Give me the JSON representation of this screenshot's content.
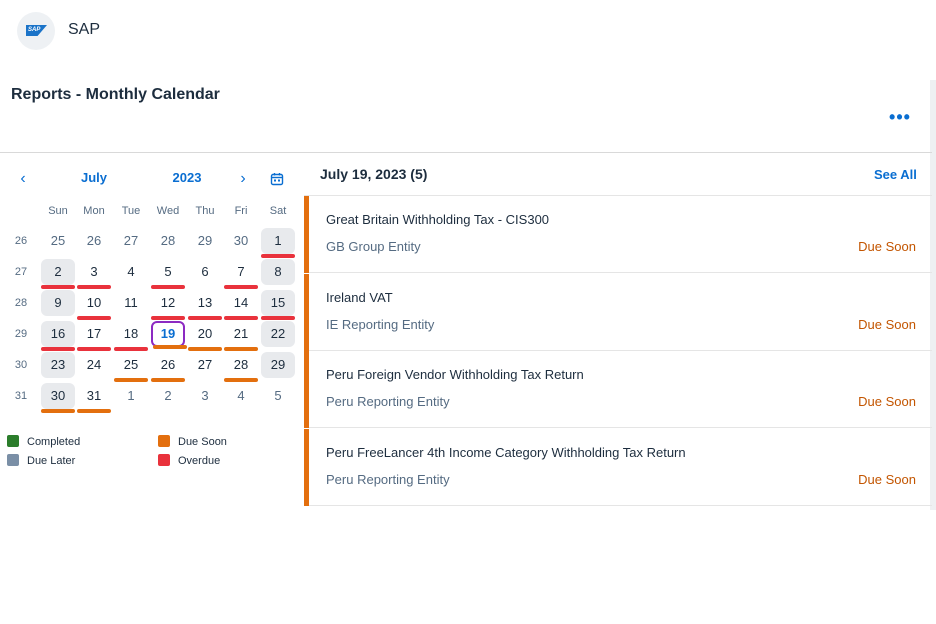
{
  "shell": {
    "logo_text": "SAP",
    "title": "SAP"
  },
  "page": {
    "title": "Reports - Monthly Calendar",
    "more_label": "•••"
  },
  "calendar": {
    "prev_label": "‹",
    "next_label": "›",
    "month": "July",
    "year": "2023",
    "weekdays": [
      "Sun",
      "Mon",
      "Tue",
      "Wed",
      "Thu",
      "Fri",
      "Sat"
    ],
    "weeks": [
      {
        "num": "26",
        "days": [
          {
            "d": "25",
            "other": true
          },
          {
            "d": "26",
            "other": true
          },
          {
            "d": "27",
            "other": true
          },
          {
            "d": "28",
            "other": true
          },
          {
            "d": "29",
            "other": true
          },
          {
            "d": "30",
            "other": true
          },
          {
            "d": "1",
            "weekend": true,
            "status": "overdue"
          }
        ]
      },
      {
        "num": "27",
        "days": [
          {
            "d": "2",
            "weekend": true,
            "status": "overdue"
          },
          {
            "d": "3",
            "status": "overdue"
          },
          {
            "d": "4"
          },
          {
            "d": "5",
            "status": "overdue"
          },
          {
            "d": "6"
          },
          {
            "d": "7",
            "status": "overdue"
          },
          {
            "d": "8",
            "weekend": true
          }
        ]
      },
      {
        "num": "28",
        "days": [
          {
            "d": "9",
            "weekend": true
          },
          {
            "d": "10",
            "status": "overdue"
          },
          {
            "d": "11"
          },
          {
            "d": "12",
            "status": "overdue"
          },
          {
            "d": "13",
            "status": "overdue"
          },
          {
            "d": "14",
            "status": "overdue"
          },
          {
            "d": "15",
            "weekend": true,
            "status": "overdue"
          }
        ]
      },
      {
        "num": "29",
        "days": [
          {
            "d": "16",
            "weekend": true,
            "status": "overdue"
          },
          {
            "d": "17",
            "status": "overdue"
          },
          {
            "d": "18",
            "status": "overdue"
          },
          {
            "d": "19",
            "today": true,
            "status": "soon"
          },
          {
            "d": "20",
            "status": "soon"
          },
          {
            "d": "21",
            "status": "soon"
          },
          {
            "d": "22",
            "weekend": true
          }
        ]
      },
      {
        "num": "30",
        "days": [
          {
            "d": "23",
            "weekend": true
          },
          {
            "d": "24"
          },
          {
            "d": "25",
            "status": "soon"
          },
          {
            "d": "26",
            "status": "soon"
          },
          {
            "d": "27"
          },
          {
            "d": "28",
            "status": "soon"
          },
          {
            "d": "29",
            "weekend": true
          }
        ]
      },
      {
        "num": "31",
        "days": [
          {
            "d": "30",
            "weekend": true,
            "status": "soon"
          },
          {
            "d": "31",
            "status": "soon"
          },
          {
            "d": "1",
            "other": true
          },
          {
            "d": "2",
            "other": true
          },
          {
            "d": "3",
            "other": true
          },
          {
            "d": "4",
            "other": true
          },
          {
            "d": "5",
            "other": true
          }
        ]
      }
    ],
    "legend": [
      {
        "label": "Completed",
        "color": "#2b7d2b"
      },
      {
        "label": "Due Soon",
        "color": "#e36f0e"
      },
      {
        "label": "Due Later",
        "color": "#7a8fa6"
      },
      {
        "label": "Overdue",
        "color": "#e9323c"
      }
    ]
  },
  "panel": {
    "heading": "July 19, 2023 (5)",
    "see_all": "See All",
    "items": [
      {
        "title": "Great Britain Withholding Tax - CIS300",
        "entity": "GB Group Entity",
        "status": "Due Soon"
      },
      {
        "title": "Ireland VAT",
        "entity": "IE Reporting Entity",
        "status": "Due Soon"
      },
      {
        "title": "Peru Foreign Vendor Withholding Tax Return",
        "entity": "Peru Reporting Entity",
        "status": "Due Soon"
      },
      {
        "title": "Peru FreeLancer 4th Income Category Withholding Tax Return",
        "entity": "Peru Reporting Entity",
        "status": "Due Soon"
      }
    ]
  }
}
